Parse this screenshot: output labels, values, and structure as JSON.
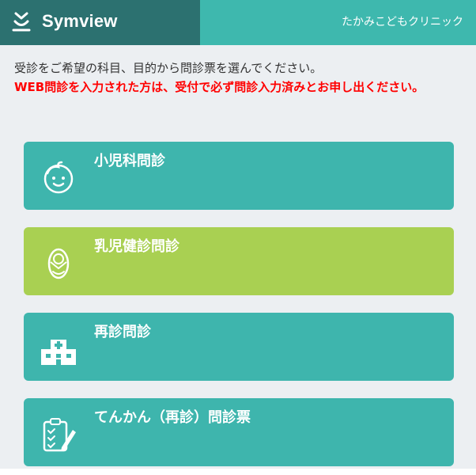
{
  "header": {
    "brand": "Symview",
    "clinic_name": "たかみこどもクリニック",
    "colors": {
      "brand_bg": "#2c7170",
      "bar_bg": "#3eb8ae"
    }
  },
  "intro_text": "受診をご希望の科目、目的から問診票を選んでください。",
  "notice_text": "WEB問診を入力された方は、受付で必ず問診入力済みとお申し出ください。",
  "menu": [
    {
      "label": "小児科問診",
      "icon": "child-face-icon",
      "color": "#3eb5ad"
    },
    {
      "label": "乳児健診問診",
      "icon": "swaddled-baby-icon",
      "color": "#a9d052"
    },
    {
      "label": "再診問診",
      "icon": "hospital-icon",
      "color": "#3eb5ad"
    },
    {
      "label": "てんかん（再診）問診票",
      "icon": "clipboard-pen-icon",
      "color": "#3eb5ad"
    }
  ]
}
